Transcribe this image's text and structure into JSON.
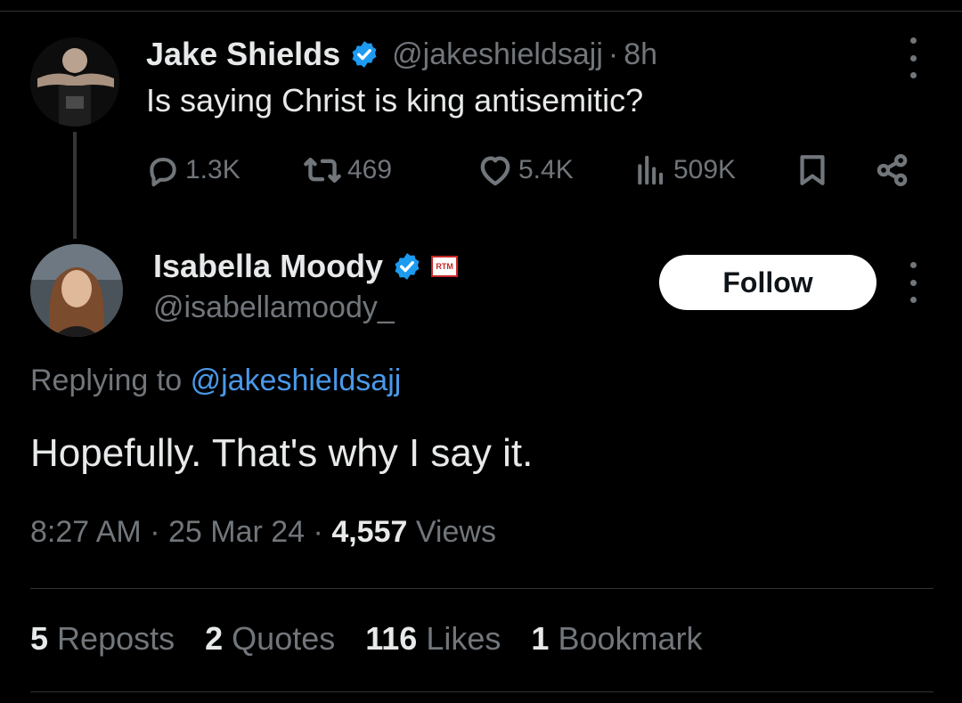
{
  "parent_tweet": {
    "author_name": "Jake Shields",
    "handle": "@jakeshieldsajj",
    "separator": "·",
    "time_ago": "8h",
    "text": "Is saying Christ is king antisemitic?",
    "actions": {
      "replies": "1.3K",
      "reposts": "469",
      "likes": "5.4K",
      "views": "509K"
    }
  },
  "reply_tweet": {
    "author_name": "Isabella Moody",
    "handle": "@isabellamoody_",
    "affiliate_badge": "RTM",
    "follow_label": "Follow",
    "replying_prefix": "Replying to",
    "replying_handle": "@jakeshieldsajj",
    "text": "Hopefully. That's why I say it.",
    "time": "8:27 AM",
    "date": "25 Mar 24",
    "separator": "·",
    "views_count": "4,557",
    "views_label": "Views",
    "stats": {
      "reposts_count": "5",
      "reposts_label": "Reposts",
      "quotes_count": "2",
      "quotes_label": "Quotes",
      "likes_count": "116",
      "likes_label": "Likes",
      "bookmarks_count": "1",
      "bookmarks_label": "Bookmark"
    }
  },
  "icons": {
    "verified": "verified-badge-icon",
    "reply": "reply-icon",
    "repost": "repost-icon",
    "like": "heart-icon",
    "views": "views-chart-icon",
    "bookmark": "bookmark-icon",
    "share": "share-icon",
    "more": "more-vertical-icon"
  },
  "colors": {
    "background": "#000000",
    "text": "#e7e9ea",
    "muted": "#71767b",
    "accent": "#1d9bf0",
    "mention": "#4a99e9"
  }
}
